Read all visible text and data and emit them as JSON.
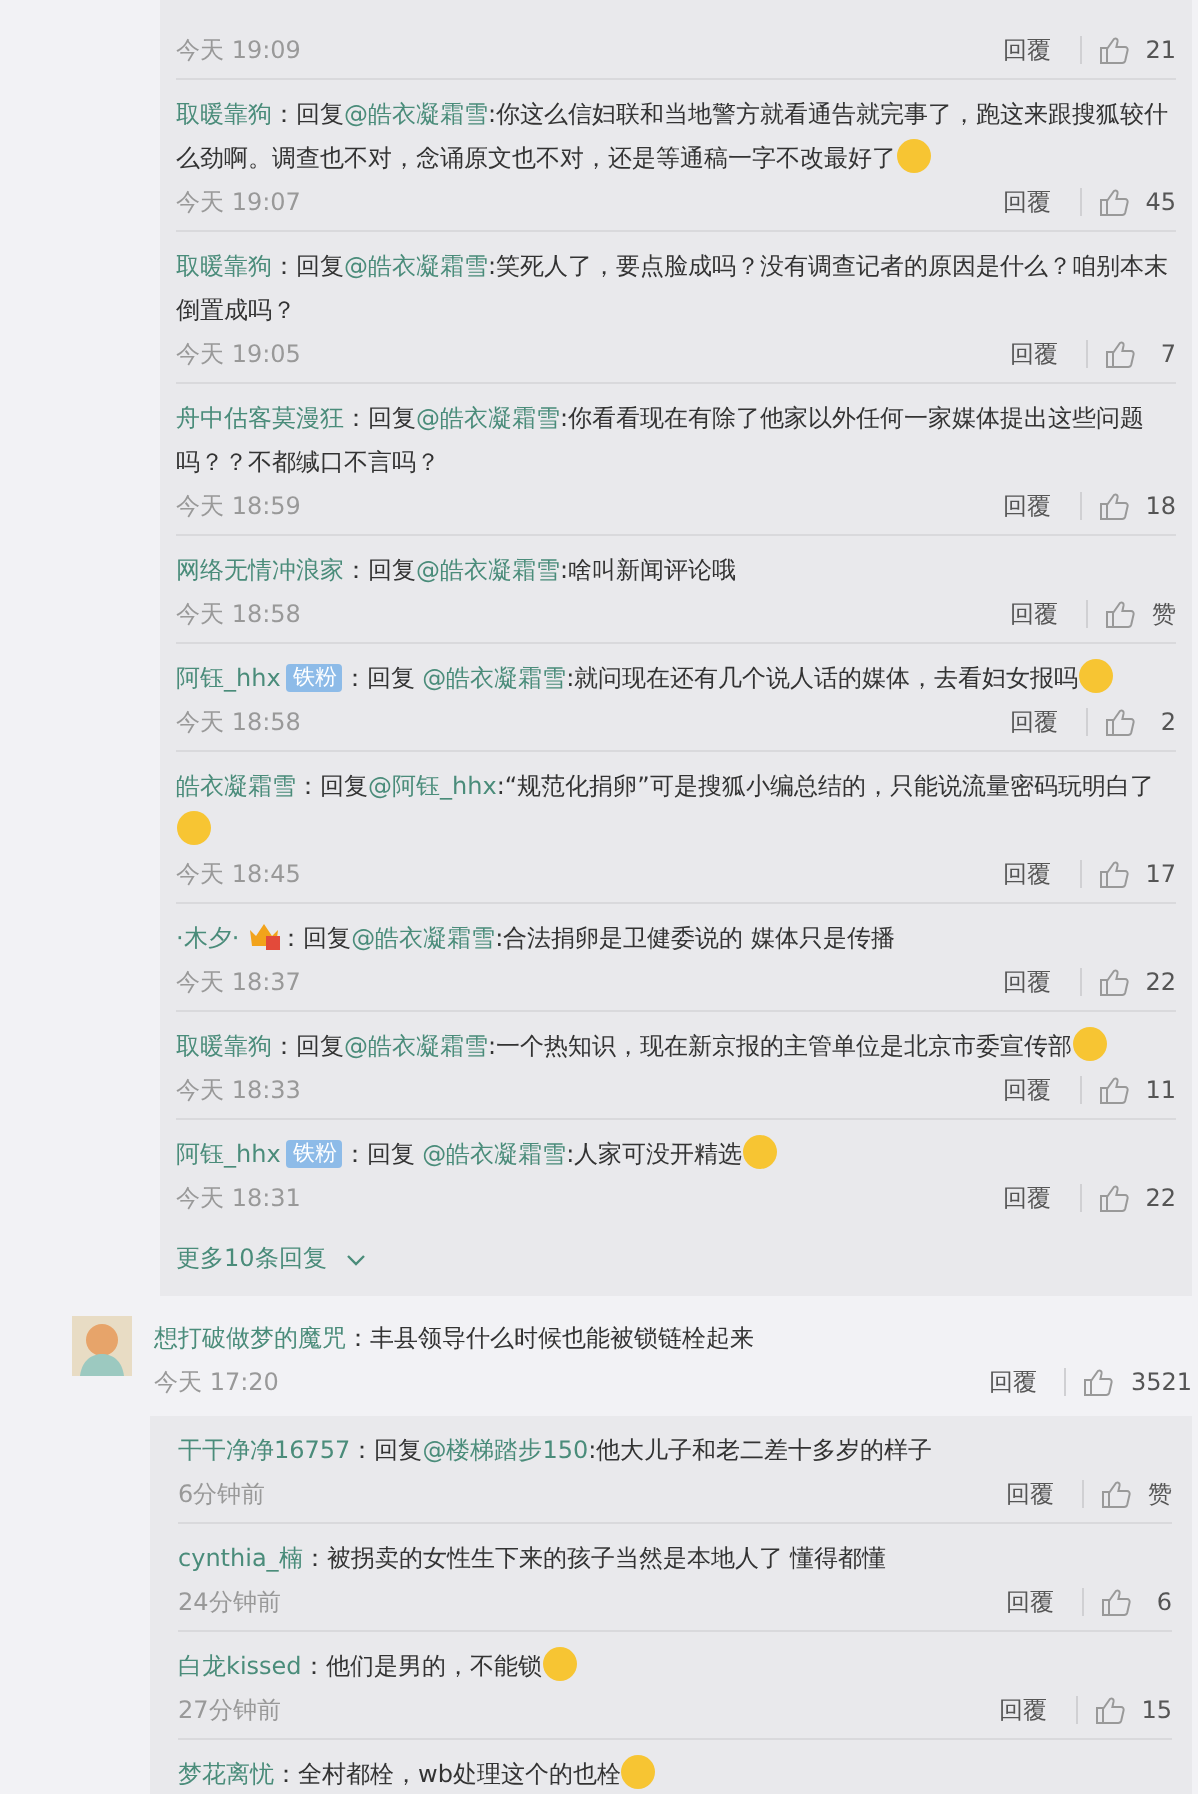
{
  "thread": {
    "replies": [
      {
        "time": "今天 19:09",
        "reply_label": "回覆",
        "likes": "21"
      },
      {
        "name": "取暖靠狗",
        "before": "：回复",
        "mention": "@皓衣凝霜雪",
        "after": ":你这么信妇联和当地警方就看通告就完事了，跑这来跟搜狐较什么劲啊。调查也不对，念诵原文也不对，还是等通稿一字不改最好了",
        "emoji": true,
        "time": "今天 19:07",
        "reply_label": "回覆",
        "likes": "45"
      },
      {
        "name": "取暖靠狗",
        "before": "：回复",
        "mention": "@皓衣凝霜雪",
        "after": ":笑死人了，要点脸成吗？没有调查记者的原因是什么？咱别本末倒置成吗？",
        "time": "今天 19:05",
        "reply_label": "回覆",
        "likes": "7"
      },
      {
        "name": "舟中估客莫漫狂",
        "before": "：回复",
        "mention": "@皓衣凝霜雪",
        "after": ":你看看现在有除了他家以外任何一家媒体提出这些问题吗？？不都缄口不言吗？",
        "time": "今天 18:59",
        "reply_label": "回覆",
        "likes": "18"
      },
      {
        "name": "网络无情冲浪家",
        "before": "：回复",
        "mention": "@皓衣凝霜雪",
        "after": ":啥叫新闻评论哦",
        "time": "今天 18:58",
        "reply_label": "回覆",
        "likes": "赞"
      },
      {
        "name": "阿钰_hhx",
        "badge": "铁粉",
        "before": "：回复 ",
        "mention": "@皓衣凝霜雪",
        "after": ":就问现在还有几个说人话的媒体，去看妇女报吗",
        "emoji": true,
        "time": "今天 18:58",
        "reply_label": "回覆",
        "likes": "2"
      },
      {
        "name": "皓衣凝霜雪",
        "before": "：回复",
        "mention": "@阿钰_hhx",
        "after": ":“规范化捐卵”可是搜狐小编总结的，只能说流量密码玩明白了",
        "emoji": true,
        "time": "今天 18:45",
        "reply_label": "回覆",
        "likes": "17"
      },
      {
        "name": "·木夕·",
        "vip": true,
        "before": "：回复",
        "mention": "@皓衣凝霜雪",
        "after": ":合法捐卵是卫健委说的 媒体只是传播",
        "time": "今天 18:37",
        "reply_label": "回覆",
        "likes": "22"
      },
      {
        "name": "取暖靠狗",
        "before": "：回复",
        "mention": "@皓衣凝霜雪",
        "after": ":一个热知识，现在新京报的主管单位是北京市委宣传部",
        "emoji": true,
        "time": "今天 18:33",
        "reply_label": "回覆",
        "likes": "11"
      },
      {
        "name": "阿钰_hhx",
        "badge": "铁粉",
        "before": "：回复 ",
        "mention": "@皓衣凝霜雪",
        "after": ":人家可没开精选",
        "emoji": true,
        "time": "今天 18:31",
        "reply_label": "回覆",
        "likes": "22"
      }
    ],
    "more_link": "更多10条回复"
  },
  "comment": {
    "name": "想打破做梦的魔咒",
    "before": "：丰县领导什么时候也能被锁链栓起来",
    "time": "今天 17:20",
    "reply_label": "回覆",
    "likes": "3521",
    "replies": [
      {
        "name": "干干净净16757",
        "before": "：回复",
        "mention": "@楼梯踏步150",
        "after": ":他大儿子和老二差十多岁的样子",
        "time": "6分钟前",
        "reply_label": "回覆",
        "likes": "赞"
      },
      {
        "name": "cynthia_楠",
        "before": "：被拐卖的女性生下来的孩子当然是本地人了 懂得都懂",
        "time": "24分钟前",
        "reply_label": "回覆",
        "likes": "6"
      },
      {
        "name": "白龙kissed",
        "before": "：他们是男的，不能锁",
        "emoji": true,
        "time": "27分钟前",
        "reply_label": "回覆",
        "likes": "15"
      },
      {
        "name": "梦花离忧",
        "before": "：全村都栓，wb处理这个的也栓",
        "emoji": true
      }
    ]
  }
}
